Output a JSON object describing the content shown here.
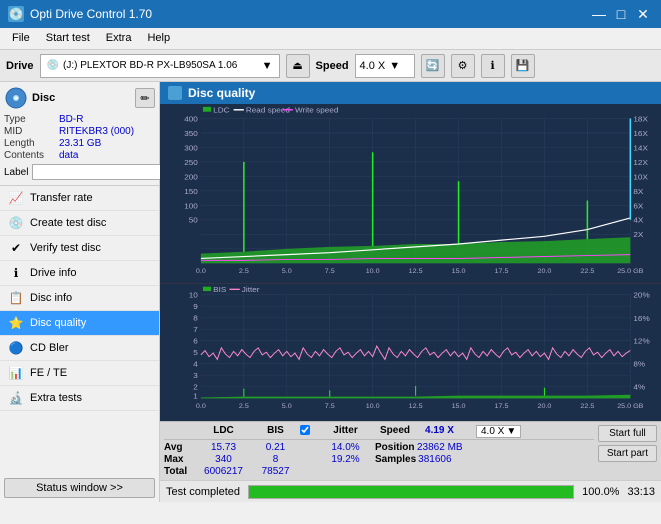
{
  "titlebar": {
    "title": "Opti Drive Control 1.70",
    "icon": "💿",
    "minimize": "—",
    "maximize": "□",
    "close": "✕"
  },
  "menubar": {
    "items": [
      "File",
      "Start test",
      "Extra",
      "Help"
    ]
  },
  "toolbar": {
    "drive_label": "Drive",
    "drive_value": "(J:)  PLEXTOR BD-R  PX-LB950SA 1.06",
    "speed_label": "Speed",
    "speed_value": "4.0 X"
  },
  "disc": {
    "title": "Disc",
    "type_label": "Type",
    "type_value": "BD-R",
    "mid_label": "MID",
    "mid_value": "RITEKBR3 (000)",
    "length_label": "Length",
    "length_value": "23.31 GB",
    "contents_label": "Contents",
    "contents_value": "data",
    "label_label": "Label",
    "label_value": ""
  },
  "nav": {
    "items": [
      {
        "id": "transfer-rate",
        "label": "Transfer rate",
        "icon": "📈"
      },
      {
        "id": "create-test-disc",
        "label": "Create test disc",
        "icon": "💿"
      },
      {
        "id": "verify-test-disc",
        "label": "Verify test disc",
        "icon": "✔"
      },
      {
        "id": "drive-info",
        "label": "Drive info",
        "icon": "ℹ"
      },
      {
        "id": "disc-info",
        "label": "Disc info",
        "icon": "📋"
      },
      {
        "id": "disc-quality",
        "label": "Disc quality",
        "icon": "⭐",
        "active": true
      },
      {
        "id": "cd-bler",
        "label": "CD Bler",
        "icon": "🔵"
      },
      {
        "id": "fe-te",
        "label": "FE / TE",
        "icon": "📊"
      },
      {
        "id": "extra-tests",
        "label": "Extra tests",
        "icon": "🔬"
      }
    ],
    "status_btn": "Status window >>"
  },
  "dq": {
    "title": "Disc quality",
    "legend": {
      "ldc": "LDC",
      "read_speed": "Read speed",
      "write_speed": "Write speed",
      "bis": "BIS",
      "jitter": "Jitter"
    }
  },
  "stats": {
    "columns": [
      "LDC",
      "BIS",
      "",
      "Jitter",
      "Speed",
      "4.19 X",
      "",
      "4.0 X"
    ],
    "avg_label": "Avg",
    "avg_ldc": "15.73",
    "avg_bis": "0.21",
    "avg_jitter": "14.0%",
    "max_label": "Max",
    "max_ldc": "340",
    "max_bis": "8",
    "max_jitter": "19.2%",
    "total_label": "Total",
    "total_ldc": "6006217",
    "total_bis": "78527",
    "position_label": "Position",
    "position_value": "23862 MB",
    "samples_label": "Samples",
    "samples_value": "381606"
  },
  "buttons": {
    "start_full": "Start full",
    "start_part": "Start part"
  },
  "statusbar": {
    "status_text": "Test completed",
    "progress": "100.0%",
    "time": "33:13"
  },
  "chart_top": {
    "y_left_max": "400",
    "y_left_vals": [
      "400",
      "350",
      "300",
      "250",
      "200",
      "150",
      "100",
      "50"
    ],
    "y_right_vals": [
      "18X",
      "16X",
      "14X",
      "12X",
      "10X",
      "8X",
      "6X",
      "4X",
      "2X"
    ],
    "x_vals": [
      "0.0",
      "2.5",
      "5.0",
      "7.5",
      "10.0",
      "12.5",
      "15.0",
      "17.5",
      "20.0",
      "22.5",
      "25.0 GB"
    ]
  },
  "chart_bottom": {
    "y_left_vals": [
      "10",
      "9",
      "8",
      "7",
      "6",
      "5",
      "4",
      "3",
      "2",
      "1"
    ],
    "y_right_vals": [
      "20%",
      "16%",
      "12%",
      "8%",
      "4%"
    ],
    "x_vals": [
      "0.0",
      "2.5",
      "5.0",
      "7.5",
      "10.0",
      "12.5",
      "15.0",
      "17.5",
      "20.0",
      "22.5",
      "25.0 GB"
    ]
  }
}
